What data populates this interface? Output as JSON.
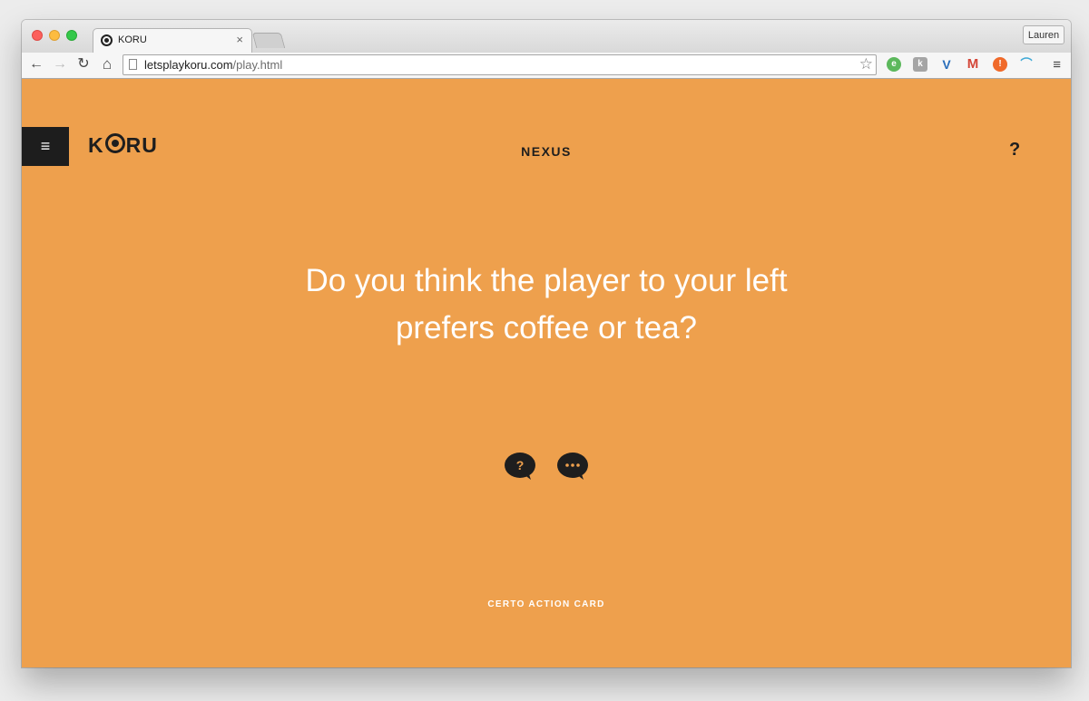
{
  "browser": {
    "tab_title": "KORU",
    "tab_close": "×",
    "profile_name": "Lauren",
    "url_host": "letsplaykoru.com",
    "url_path": "/play.html",
    "nav": {
      "back": "←",
      "forward": "→",
      "reload": "↻",
      "home": "⌂"
    },
    "star": "☆",
    "menu": "≡",
    "extensions": [
      {
        "name": "evernote-extension",
        "icon": "elephant-icon",
        "color": "#5cb85c"
      },
      {
        "name": "koala-extension",
        "icon": "koala-icon",
        "color": "#9a9a9a"
      },
      {
        "name": "v-extension",
        "icon": "v-icon",
        "color": "#2a6ebb"
      },
      {
        "name": "gmail-extension",
        "icon": "gmail-icon",
        "color": "#d44638"
      },
      {
        "name": "alert-extension",
        "icon": "exclamation-icon",
        "color": "#f06a2a"
      },
      {
        "name": "rainbow-extension",
        "icon": "rainbow-icon",
        "color": "#3fa9d6"
      }
    ]
  },
  "app": {
    "menu_label": "≡",
    "logo_part1": "K",
    "logo_part2": "RU",
    "section_title": "NEXUS",
    "help_label": "?",
    "question": "Do you think the player to your left prefers coffee or tea?",
    "question_line1": "Do you think the player to your left",
    "question_line2": "prefers coffee or tea?",
    "actions": [
      {
        "name": "question-bubble-button",
        "icon": "question-bubble-icon",
        "glyph": "?"
      },
      {
        "name": "discuss-bubble-button",
        "icon": "ellipsis-bubble-icon",
        "glyph": "..."
      }
    ],
    "card_type": "CERTO ACTION CARD",
    "background_color": "#eea04d",
    "dark_color": "#1e1e1e"
  }
}
